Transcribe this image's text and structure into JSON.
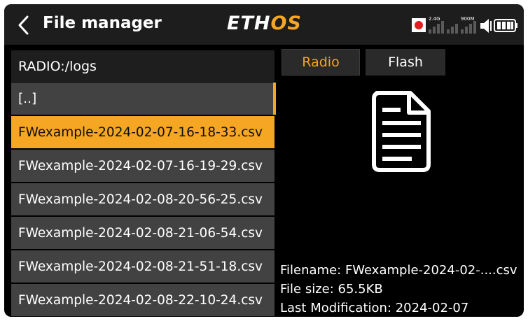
{
  "header": {
    "title": "File manager",
    "brand_part1": "ETH",
    "brand_part2": "OS",
    "signal_24": "2.4G",
    "signal_900": "900M"
  },
  "left_panel": {
    "path": "RADIO:/logs",
    "items": [
      "[..]",
      "FWexample-2024-02-07-16-18-33.csv",
      "FWexample-2024-02-07-16-19-29.csv",
      "FWexample-2024-02-08-20-56-25.csv",
      "FWexample-2024-02-08-21-06-54.csv",
      "FWexample-2024-02-08-21-51-18.csv",
      "FWexample-2024-02-08-22-10-24.csv"
    ],
    "selected_index": 1
  },
  "tabs": {
    "radio": "Radio",
    "flash": "Flash",
    "active": "Radio"
  },
  "details": {
    "filename": "Filename: FWexample-2024-02-....csv",
    "size": "File size: 65.5KB",
    "modified": "Last Modification: 2024-02-07"
  },
  "icons": [
    "back-arrow-icon",
    "record-icon",
    "signal-bars-icon",
    "speaker-icon",
    "battery-icon",
    "document-icon"
  ],
  "colors": {
    "accent": "#f5a623",
    "background": "#000000",
    "header": "#1d1d1d",
    "list_item": "#424242"
  }
}
